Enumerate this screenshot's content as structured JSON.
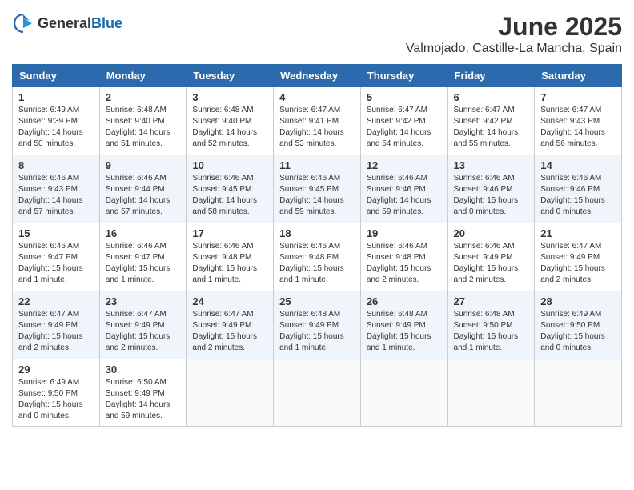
{
  "header": {
    "logo_general": "General",
    "logo_blue": "Blue",
    "month_year": "June 2025",
    "location": "Valmojado, Castille-La Mancha, Spain"
  },
  "weekdays": [
    "Sunday",
    "Monday",
    "Tuesday",
    "Wednesday",
    "Thursday",
    "Friday",
    "Saturday"
  ],
  "weeks": [
    [
      {
        "day": "1",
        "sunrise": "6:49 AM",
        "sunset": "9:39 PM",
        "daylight": "14 hours and 50 minutes."
      },
      {
        "day": "2",
        "sunrise": "6:48 AM",
        "sunset": "9:40 PM",
        "daylight": "14 hours and 51 minutes."
      },
      {
        "day": "3",
        "sunrise": "6:48 AM",
        "sunset": "9:40 PM",
        "daylight": "14 hours and 52 minutes."
      },
      {
        "day": "4",
        "sunrise": "6:47 AM",
        "sunset": "9:41 PM",
        "daylight": "14 hours and 53 minutes."
      },
      {
        "day": "5",
        "sunrise": "6:47 AM",
        "sunset": "9:42 PM",
        "daylight": "14 hours and 54 minutes."
      },
      {
        "day": "6",
        "sunrise": "6:47 AM",
        "sunset": "9:42 PM",
        "daylight": "14 hours and 55 minutes."
      },
      {
        "day": "7",
        "sunrise": "6:47 AM",
        "sunset": "9:43 PM",
        "daylight": "14 hours and 56 minutes."
      }
    ],
    [
      {
        "day": "8",
        "sunrise": "6:46 AM",
        "sunset": "9:43 PM",
        "daylight": "14 hours and 57 minutes."
      },
      {
        "day": "9",
        "sunrise": "6:46 AM",
        "sunset": "9:44 PM",
        "daylight": "14 hours and 57 minutes."
      },
      {
        "day": "10",
        "sunrise": "6:46 AM",
        "sunset": "9:45 PM",
        "daylight": "14 hours and 58 minutes."
      },
      {
        "day": "11",
        "sunrise": "6:46 AM",
        "sunset": "9:45 PM",
        "daylight": "14 hours and 59 minutes."
      },
      {
        "day": "12",
        "sunrise": "6:46 AM",
        "sunset": "9:46 PM",
        "daylight": "14 hours and 59 minutes."
      },
      {
        "day": "13",
        "sunrise": "6:46 AM",
        "sunset": "9:46 PM",
        "daylight": "15 hours and 0 minutes."
      },
      {
        "day": "14",
        "sunrise": "6:46 AM",
        "sunset": "9:46 PM",
        "daylight": "15 hours and 0 minutes."
      }
    ],
    [
      {
        "day": "15",
        "sunrise": "6:46 AM",
        "sunset": "9:47 PM",
        "daylight": "15 hours and 1 minute."
      },
      {
        "day": "16",
        "sunrise": "6:46 AM",
        "sunset": "9:47 PM",
        "daylight": "15 hours and 1 minute."
      },
      {
        "day": "17",
        "sunrise": "6:46 AM",
        "sunset": "9:48 PM",
        "daylight": "15 hours and 1 minute."
      },
      {
        "day": "18",
        "sunrise": "6:46 AM",
        "sunset": "9:48 PM",
        "daylight": "15 hours and 1 minute."
      },
      {
        "day": "19",
        "sunrise": "6:46 AM",
        "sunset": "9:48 PM",
        "daylight": "15 hours and 2 minutes."
      },
      {
        "day": "20",
        "sunrise": "6:46 AM",
        "sunset": "9:49 PM",
        "daylight": "15 hours and 2 minutes."
      },
      {
        "day": "21",
        "sunrise": "6:47 AM",
        "sunset": "9:49 PM",
        "daylight": "15 hours and 2 minutes."
      }
    ],
    [
      {
        "day": "22",
        "sunrise": "6:47 AM",
        "sunset": "9:49 PM",
        "daylight": "15 hours and 2 minutes."
      },
      {
        "day": "23",
        "sunrise": "6:47 AM",
        "sunset": "9:49 PM",
        "daylight": "15 hours and 2 minutes."
      },
      {
        "day": "24",
        "sunrise": "6:47 AM",
        "sunset": "9:49 PM",
        "daylight": "15 hours and 2 minutes."
      },
      {
        "day": "25",
        "sunrise": "6:48 AM",
        "sunset": "9:49 PM",
        "daylight": "15 hours and 1 minute."
      },
      {
        "day": "26",
        "sunrise": "6:48 AM",
        "sunset": "9:49 PM",
        "daylight": "15 hours and 1 minute."
      },
      {
        "day": "27",
        "sunrise": "6:48 AM",
        "sunset": "9:50 PM",
        "daylight": "15 hours and 1 minute."
      },
      {
        "day": "28",
        "sunrise": "6:49 AM",
        "sunset": "9:50 PM",
        "daylight": "15 hours and 0 minutes."
      }
    ],
    [
      {
        "day": "29",
        "sunrise": "6:49 AM",
        "sunset": "9:50 PM",
        "daylight": "15 hours and 0 minutes."
      },
      {
        "day": "30",
        "sunrise": "6:50 AM",
        "sunset": "9:49 PM",
        "daylight": "14 hours and 59 minutes."
      },
      null,
      null,
      null,
      null,
      null
    ]
  ]
}
